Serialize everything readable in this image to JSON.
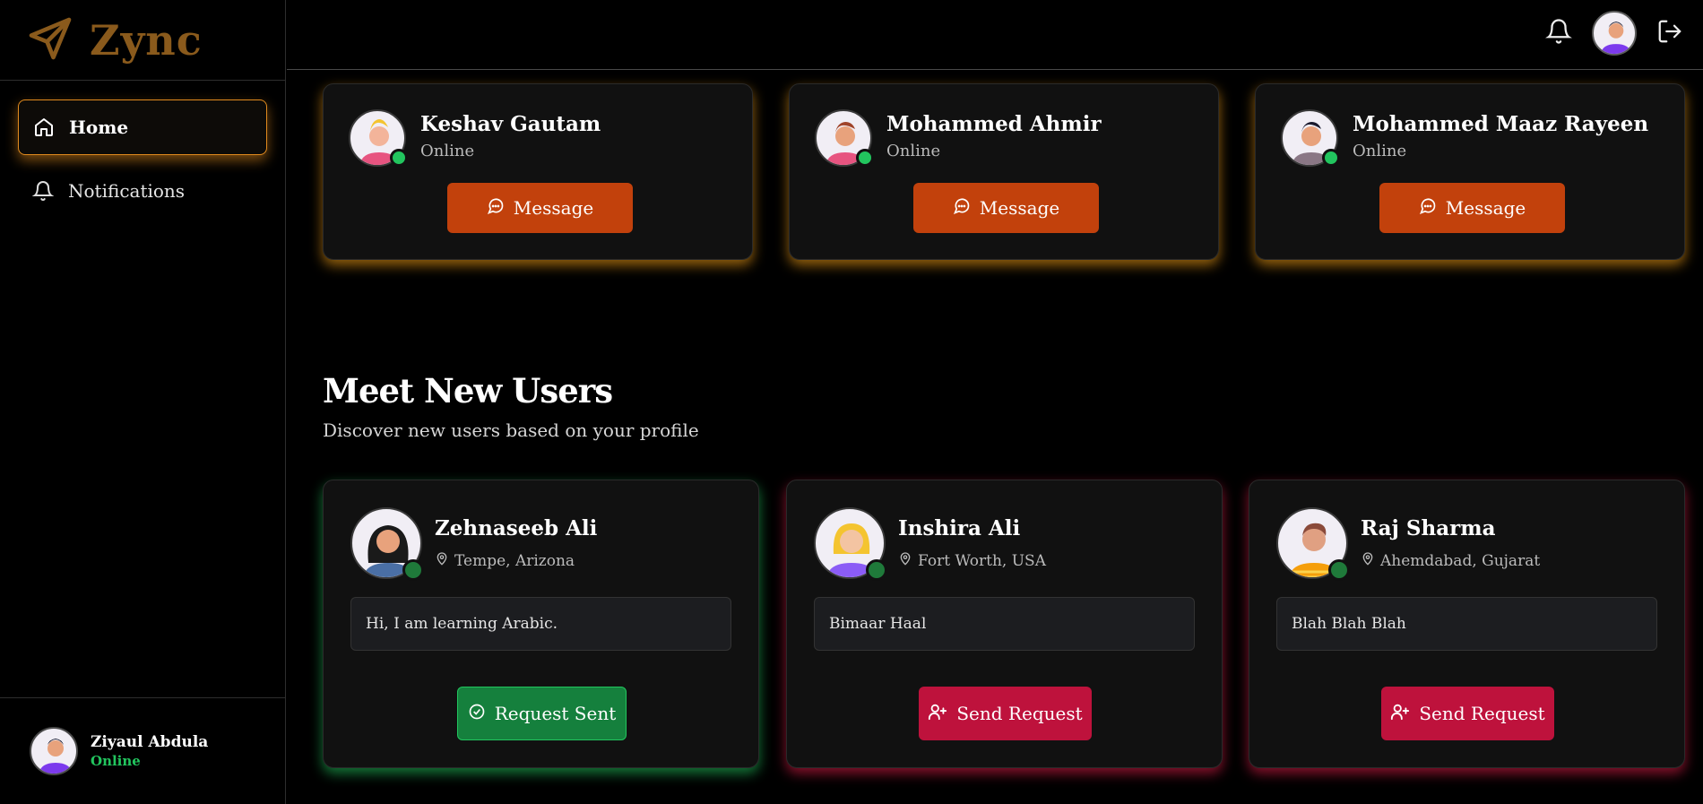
{
  "brand": {
    "name": "Zync",
    "color": "#8a5a1c"
  },
  "nav": {
    "items": [
      {
        "label": "Home",
        "icon": "home-icon",
        "active": true
      },
      {
        "label": "Notifications",
        "icon": "bell-icon",
        "active": false
      }
    ]
  },
  "current_user": {
    "name": "Ziyaul Abdula",
    "status": "Online"
  },
  "friends": [
    {
      "name": "Keshav Gautam",
      "status": "Online",
      "button": "Message"
    },
    {
      "name": "Mohammed Ahmir",
      "status": "Online",
      "button": "Message"
    },
    {
      "name": "Mohammed Maaz Rayeen",
      "status": "Online",
      "button": "Message"
    }
  ],
  "section": {
    "title": "Meet New Users",
    "subtitle": "Discover new users based on your profile"
  },
  "new_users": [
    {
      "name": "Zehnaseeb Ali",
      "location": "Tempe, Arizona",
      "bio": "Hi, I am learning Arabic.",
      "button": "Request Sent",
      "state": "sent"
    },
    {
      "name": "Inshira Ali",
      "location": "Fort Worth, USA",
      "bio": "Bimaar Haal",
      "button": "Send Request",
      "state": "send"
    },
    {
      "name": "Raj Sharma",
      "location": "Ahemdabad, Gujarat",
      "bio": "Blah Blah Blah",
      "button": "Send Request",
      "state": "send"
    }
  ],
  "colors": {
    "accent_orange": "#c2410c",
    "online_green": "#22c55e",
    "sent_green": "#15803d",
    "send_red": "#be123c"
  }
}
